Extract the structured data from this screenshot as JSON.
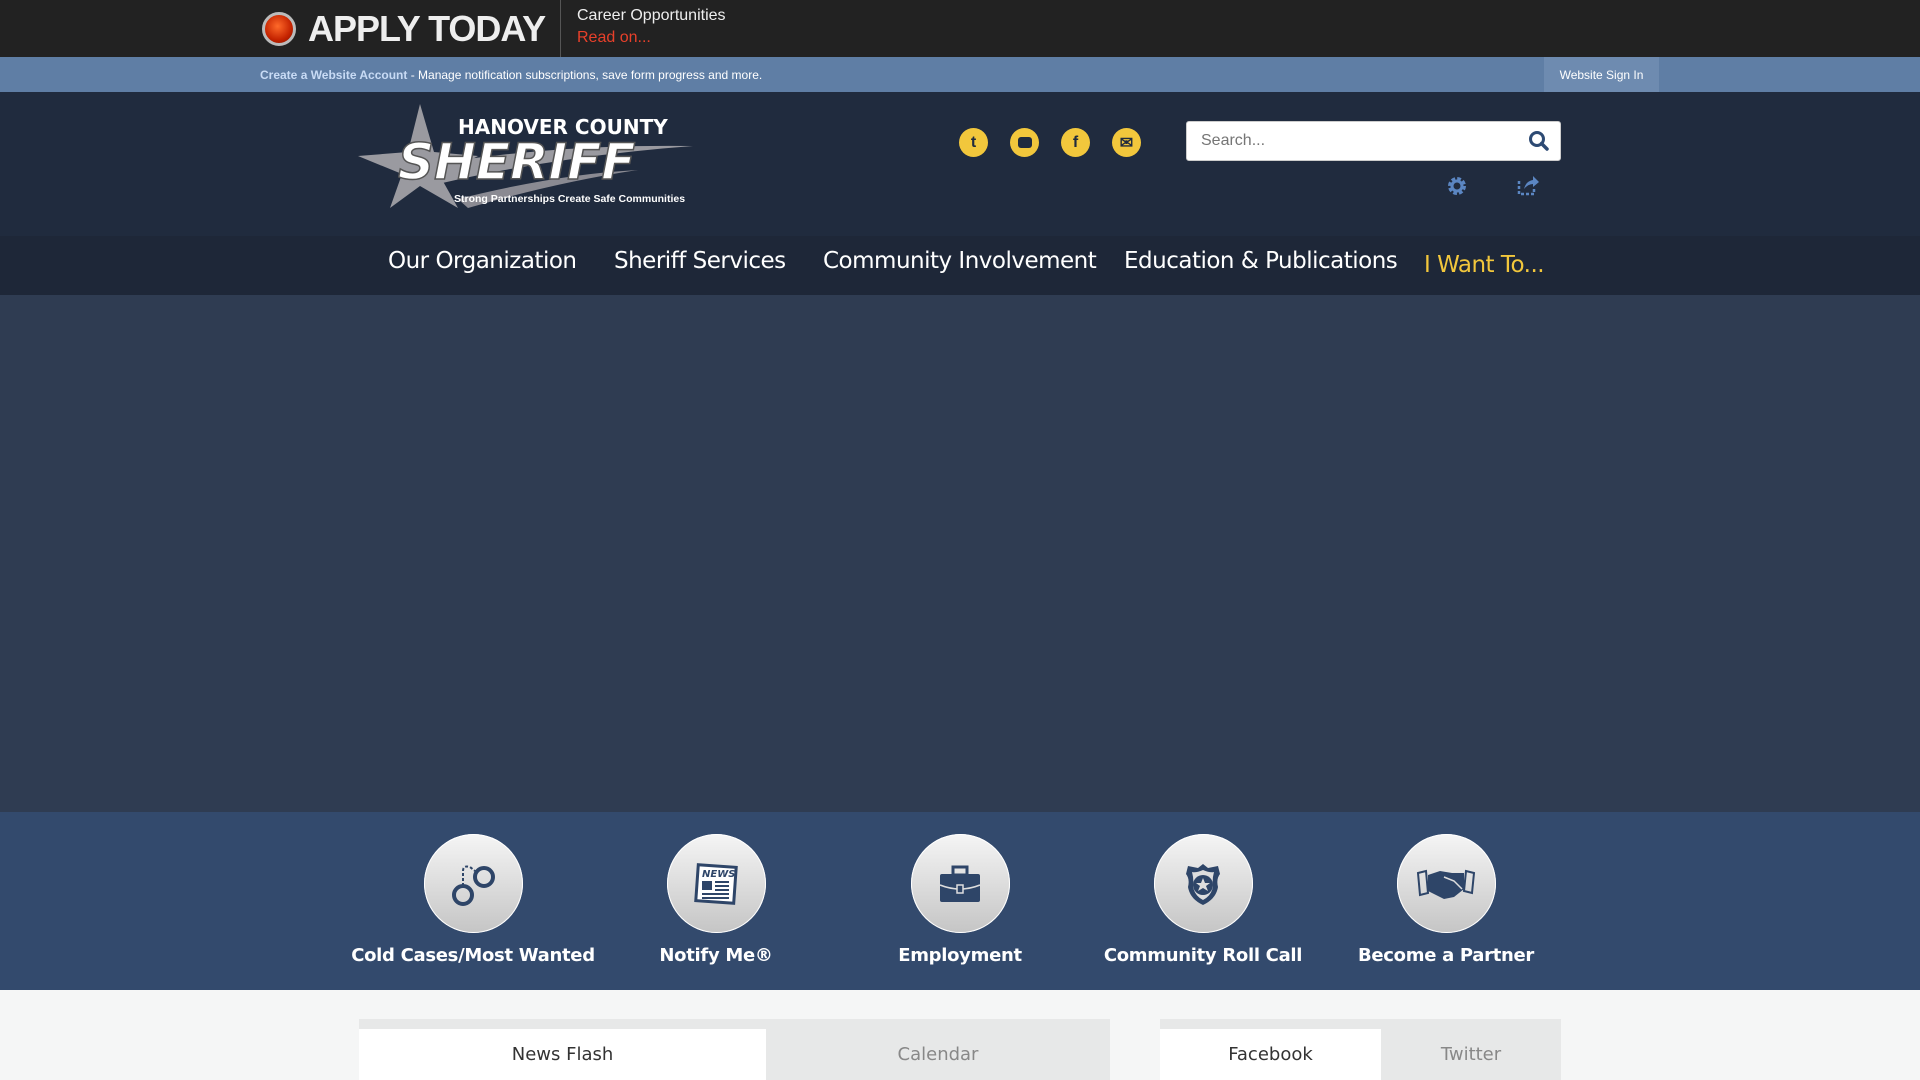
{
  "alert": {
    "title": "APPLY TODAY",
    "headline": "Career Opportunities",
    "link": "Read on..."
  },
  "account_bar": {
    "link": "Create a Website Account",
    "text": " - Manage notification subscriptions, save form progress and more.",
    "sign_in": "Website Sign In"
  },
  "logo": {
    "line1": "HANOVER COUNTY",
    "line2": "SHERIFF",
    "tagline": "Strong Partnerships Create Safe Communities"
  },
  "social": [
    "twitter-icon",
    "youtube-icon",
    "facebook-icon",
    "email-icon"
  ],
  "search": {
    "placeholder": "Search..."
  },
  "nav": [
    {
      "label": "Our Organization"
    },
    {
      "label": "Sheriff Services"
    },
    {
      "label": "Community Involvement"
    },
    {
      "label": "Education & Publications"
    },
    {
      "label": "I Want To..."
    }
  ],
  "quick_links": [
    {
      "label": "Cold Cases/Most Wanted",
      "icon": "handcuffs-icon"
    },
    {
      "label": "Notify Me®",
      "icon": "newspaper-icon"
    },
    {
      "label": "Employment",
      "icon": "briefcase-icon"
    },
    {
      "label": "Community Roll Call",
      "icon": "badge-icon"
    },
    {
      "label": "Become a Partner",
      "icon": "handshake-icon"
    }
  ],
  "tabs_left": [
    {
      "label": "News Flash",
      "active": true
    },
    {
      "label": "Calendar",
      "active": false
    }
  ],
  "tabs_right": [
    {
      "label": "Facebook",
      "active": true
    },
    {
      "label": "Twitter",
      "active": false
    }
  ],
  "colors": {
    "accent": "#f2c73c",
    "alert_link": "#e8402a",
    "account_bar": "#5f7ea5",
    "header": "#202b3e",
    "quick_links_bg": "#334a6d"
  }
}
